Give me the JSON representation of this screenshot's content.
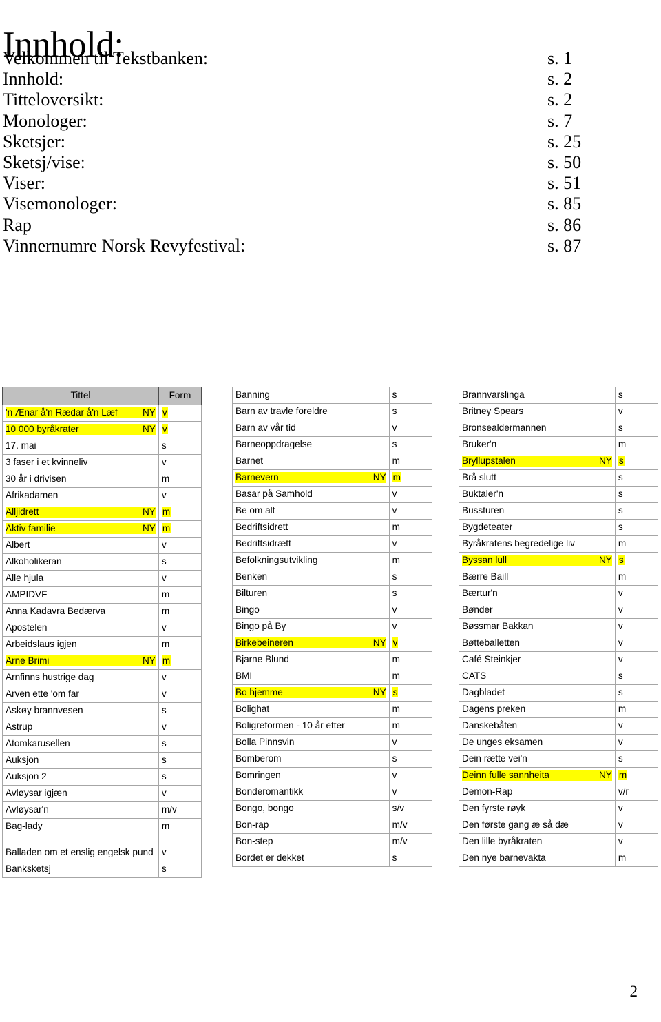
{
  "document": {
    "heading": "Innhold:",
    "page_number": "2"
  },
  "toc": {
    "entries": [
      {
        "label": "Velkommen til Tekstbanken:",
        "page": "s. 1"
      },
      {
        "label": "Innhold:",
        "page": "s. 2"
      },
      {
        "label": "Titteloversikt:",
        "page": "s. 2"
      },
      {
        "label": "Monologer:",
        "page": "s. 7"
      },
      {
        "label": "Sketsjer:",
        "page": "s. 25"
      },
      {
        "label": "Sketsj/vise:",
        "page": "s. 50"
      },
      {
        "label": "Viser:",
        "page": "s. 51"
      },
      {
        "label": "Visemonologer:",
        "page": "s. 85"
      },
      {
        "label": "Rap",
        "page": "s. 86"
      },
      {
        "label": "Vinnernumre Norsk Revyfestival:",
        "page": "s. 87"
      }
    ]
  },
  "table": {
    "headers": {
      "title": "Tittel",
      "form": "Form"
    },
    "new_marker": "NY",
    "highlight_color": "#ffff00",
    "header_bg": "#c0c0c0",
    "columns": [
      {
        "rows": [
          {
            "title": "'n Ænar å'n Rædar å'n Læf",
            "ny": "NY",
            "form": "v",
            "highlight": true
          },
          {
            "title": "10 000 byråkrater",
            "ny": "NY",
            "form": "v",
            "highlight": true
          },
          {
            "title": "17. mai",
            "ny": "",
            "form": "s",
            "highlight": false
          },
          {
            "title": "3 faser i et kvinneliv",
            "ny": "",
            "form": "v",
            "highlight": false
          },
          {
            "title": "30 år i drivisen",
            "ny": "",
            "form": "m",
            "highlight": false
          },
          {
            "title": "Afrikadamen",
            "ny": "",
            "form": "v",
            "highlight": false
          },
          {
            "title": "Alljidrett",
            "ny": "NY",
            "form": "m",
            "highlight": true
          },
          {
            "title": "Aktiv familie",
            "ny": "NY",
            "form": "m",
            "highlight": true
          },
          {
            "title": "Albert",
            "ny": "",
            "form": "v",
            "highlight": false
          },
          {
            "title": "Alkoholikeran",
            "ny": "",
            "form": "s",
            "highlight": false
          },
          {
            "title": "Alle hjula",
            "ny": "",
            "form": "v",
            "highlight": false
          },
          {
            "title": "AMPIDVF",
            "ny": "",
            "form": "m",
            "highlight": false
          },
          {
            "title": "Anna Kadavra Bedærva",
            "ny": "",
            "form": "m",
            "highlight": false
          },
          {
            "title": "Apostelen",
            "ny": "",
            "form": "v",
            "highlight": false
          },
          {
            "title": "Arbeidslaus igjen",
            "ny": "",
            "form": "m",
            "highlight": false
          },
          {
            "title": "Arne Brimi",
            "ny": "NY",
            "form": "m",
            "highlight": true
          },
          {
            "title": "Arnfinns hustrige dag",
            "ny": "",
            "form": "v",
            "highlight": false
          },
          {
            "title": "Arven ette 'om far",
            "ny": "",
            "form": "v",
            "highlight": false
          },
          {
            "title": "Askøy brannvesen",
            "ny": "",
            "form": "s",
            "highlight": false
          },
          {
            "title": "Astrup",
            "ny": "",
            "form": "v",
            "highlight": false
          },
          {
            "title": "Atomkarusellen",
            "ny": "",
            "form": "s",
            "highlight": false
          },
          {
            "title": "Auksjon",
            "ny": "",
            "form": "s",
            "highlight": false
          },
          {
            "title": "Auksjon 2",
            "ny": "",
            "form": "s",
            "highlight": false
          },
          {
            "title": "Avløysar igjæn",
            "ny": "",
            "form": "v",
            "highlight": false
          },
          {
            "title": "Avløysar'n",
            "ny": "",
            "form": "m/v",
            "highlight": false
          },
          {
            "title": "Bag-lady",
            "ny": "",
            "form": "m",
            "highlight": false
          },
          {
            "title": "Balladen om et enslig engelsk pund",
            "ny": "",
            "form": "v",
            "highlight": false,
            "wrap": true
          },
          {
            "title": "Banksketsj",
            "ny": "",
            "form": "s",
            "highlight": false
          }
        ]
      },
      {
        "rows": [
          {
            "title": "Banning",
            "ny": "",
            "form": "s",
            "highlight": false
          },
          {
            "title": "Barn av travle foreldre",
            "ny": "",
            "form": "s",
            "highlight": false
          },
          {
            "title": "Barn av vår tid",
            "ny": "",
            "form": "v",
            "highlight": false
          },
          {
            "title": "Barneoppdragelse",
            "ny": "",
            "form": "s",
            "highlight": false
          },
          {
            "title": "Barnet",
            "ny": "",
            "form": "m",
            "highlight": false
          },
          {
            "title": "Barnevern",
            "ny": "NY",
            "form": "m",
            "highlight": true
          },
          {
            "title": "Basar på Samhold",
            "ny": "",
            "form": "v",
            "highlight": false
          },
          {
            "title": "Be om alt",
            "ny": "",
            "form": "v",
            "highlight": false
          },
          {
            "title": "Bedriftsidrett",
            "ny": "",
            "form": "m",
            "highlight": false
          },
          {
            "title": "Bedriftsidrætt",
            "ny": "",
            "form": "v",
            "highlight": false
          },
          {
            "title": "Befolkningsutvikling",
            "ny": "",
            "form": "m",
            "highlight": false
          },
          {
            "title": "Benken",
            "ny": "",
            "form": "s",
            "highlight": false
          },
          {
            "title": "Bilturen",
            "ny": "",
            "form": "s",
            "highlight": false
          },
          {
            "title": "Bingo",
            "ny": "",
            "form": "v",
            "highlight": false
          },
          {
            "title": "Bingo på By",
            "ny": "",
            "form": "v",
            "highlight": false
          },
          {
            "title": "Birkebeineren",
            "ny": "NY",
            "form": "v",
            "highlight": true
          },
          {
            "title": "Bjarne Blund",
            "ny": "",
            "form": "m",
            "highlight": false
          },
          {
            "title": "BMI",
            "ny": "",
            "form": "m",
            "highlight": false
          },
          {
            "title": "Bo hjemme",
            "ny": "NY",
            "form": "s",
            "highlight": true
          },
          {
            "title": "Bolighat",
            "ny": "",
            "form": "m",
            "highlight": false
          },
          {
            "title": "Boligreformen - 10 år etter",
            "ny": "",
            "form": "m",
            "highlight": false
          },
          {
            "title": "Bolla Pinnsvin",
            "ny": "",
            "form": "v",
            "highlight": false
          },
          {
            "title": "Bomberom",
            "ny": "",
            "form": "s",
            "highlight": false
          },
          {
            "title": "Bomringen",
            "ny": "",
            "form": "v",
            "highlight": false
          },
          {
            "title": "Bonderomantikk",
            "ny": "",
            "form": "v",
            "highlight": false
          },
          {
            "title": "Bongo, bongo",
            "ny": "",
            "form": "s/v",
            "highlight": false
          },
          {
            "title": "Bon-rap",
            "ny": "",
            "form": "m/v",
            "highlight": false
          },
          {
            "title": "Bon-step",
            "ny": "",
            "form": "m/v",
            "highlight": false
          },
          {
            "title": "Bordet er dekket",
            "ny": "",
            "form": "s",
            "highlight": false
          }
        ]
      },
      {
        "rows": [
          {
            "title": "Brannvarslinga",
            "ny": "",
            "form": "s",
            "highlight": false
          },
          {
            "title": "Britney Spears",
            "ny": "",
            "form": "v",
            "highlight": false
          },
          {
            "title": "Bronsealdermannen",
            "ny": "",
            "form": "s",
            "highlight": false
          },
          {
            "title": "Bruker'n",
            "ny": "",
            "form": "m",
            "highlight": false
          },
          {
            "title": "Bryllupstalen",
            "ny": "NY",
            "form": "s",
            "highlight": true
          },
          {
            "title": "Brå slutt",
            "ny": "",
            "form": "s",
            "highlight": false
          },
          {
            "title": "Buktaler'n",
            "ny": "",
            "form": "s",
            "highlight": false
          },
          {
            "title": "Bussturen",
            "ny": "",
            "form": "s",
            "highlight": false
          },
          {
            "title": "Bygdeteater",
            "ny": "",
            "form": "s",
            "highlight": false
          },
          {
            "title": "Byråkratens begredelige liv",
            "ny": "",
            "form": "m",
            "highlight": false
          },
          {
            "title": "Byssan lull",
            "ny": "NY",
            "form": "s",
            "highlight": true
          },
          {
            "title": "Bærre Baill",
            "ny": "",
            "form": "m",
            "highlight": false
          },
          {
            "title": "Bærtur'n",
            "ny": "",
            "form": "v",
            "highlight": false
          },
          {
            "title": "Bønder",
            "ny": "",
            "form": "v",
            "highlight": false
          },
          {
            "title": "Bøssmar Bakkan",
            "ny": "",
            "form": "v",
            "highlight": false
          },
          {
            "title": "Bøtteballetten",
            "ny": "",
            "form": "v",
            "highlight": false
          },
          {
            "title": "Café Steinkjer",
            "ny": "",
            "form": "v",
            "highlight": false
          },
          {
            "title": "CATS",
            "ny": "",
            "form": "s",
            "highlight": false
          },
          {
            "title": "Dagbladet",
            "ny": "",
            "form": "s",
            "highlight": false
          },
          {
            "title": "Dagens preken",
            "ny": "",
            "form": "m",
            "highlight": false
          },
          {
            "title": "Danskebåten",
            "ny": "",
            "form": "v",
            "highlight": false
          },
          {
            "title": "De unges eksamen",
            "ny": "",
            "form": "v",
            "highlight": false
          },
          {
            "title": "Dein rætte vei'n",
            "ny": "",
            "form": "s",
            "highlight": false
          },
          {
            "title": "Deinn fulle sannheita",
            "ny": "NY",
            "form": "m",
            "highlight": true
          },
          {
            "title": "Demon-Rap",
            "ny": "",
            "form": "v/r",
            "highlight": false
          },
          {
            "title": "Den fyrste røyk",
            "ny": "",
            "form": "v",
            "highlight": false
          },
          {
            "title": "Den første gang æ så dæ",
            "ny": "",
            "form": "v",
            "highlight": false
          },
          {
            "title": "Den lille byråkraten",
            "ny": "",
            "form": "v",
            "highlight": false
          },
          {
            "title": "Den nye barnevakta",
            "ny": "",
            "form": "m",
            "highlight": false
          }
        ]
      }
    ]
  }
}
